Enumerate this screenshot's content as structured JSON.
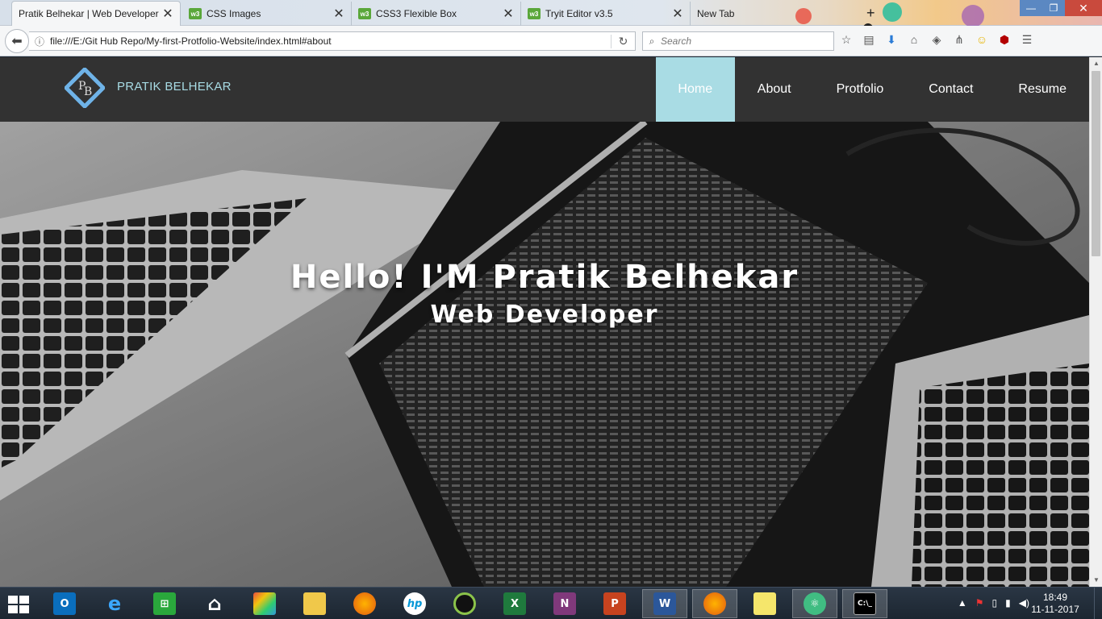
{
  "browser": {
    "tabs": [
      {
        "title": "Pratik Belhekar | Web Developer",
        "active": true,
        "icon": "page-icon"
      },
      {
        "title": "CSS Images",
        "active": false,
        "icon": "w3schools-icon"
      },
      {
        "title": "CSS3 Flexible Box",
        "active": false,
        "icon": "w3schools-icon"
      },
      {
        "title": "Tryit Editor v3.5",
        "active": false,
        "icon": "w3schools-icon"
      },
      {
        "title": "New Tab",
        "active": false,
        "icon": "none"
      }
    ],
    "url": "file:///E:/Git Hub Repo/My-first-Protfolio-Website/index.html#about",
    "search_placeholder": "Search",
    "favicon_text": "w3"
  },
  "site": {
    "logo_initials": "PB",
    "brand": "PRATIK BELHEKAR",
    "nav": [
      {
        "label": "Home",
        "active": true
      },
      {
        "label": "About",
        "active": false
      },
      {
        "label": "Protfolio",
        "active": false
      },
      {
        "label": "Contact",
        "active": false
      },
      {
        "label": "Resume",
        "active": false
      }
    ],
    "hero_title": "Hello! I'M Pratik Belhekar",
    "hero_subtitle": "Web Developer",
    "accent_color": "#a9dce4",
    "header_color": "#323232"
  },
  "taskbar": {
    "apps": [
      "outlook-icon",
      "internet-explorer-icon",
      "store-icon",
      "home-icon",
      "paint-icon",
      "file-explorer-icon",
      "firefox-icon",
      "hp-icon",
      "camera-icon",
      "excel-icon",
      "onenote-icon",
      "powerpoint-icon",
      "word-icon",
      "firefox-icon",
      "sticky-notes-icon",
      "atom-icon",
      "command-prompt-icon"
    ],
    "time": "18:49",
    "date": "11-11-2017"
  }
}
